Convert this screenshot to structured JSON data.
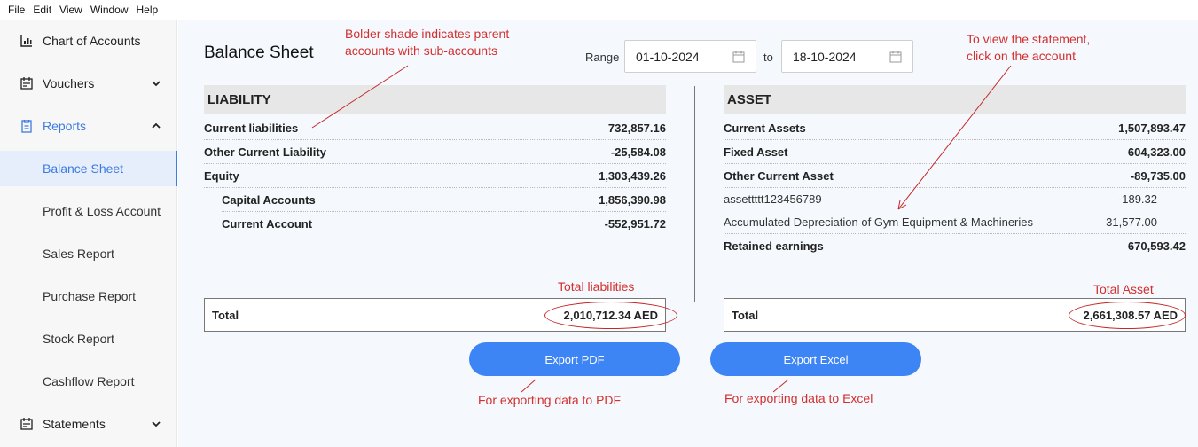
{
  "menu": [
    "File",
    "Edit",
    "View",
    "Window",
    "Help"
  ],
  "sidebar": {
    "items": [
      {
        "label": "Chart of Accounts",
        "icon": "chart-icon"
      },
      {
        "label": "Vouchers",
        "icon": "voucher-icon"
      },
      {
        "label": "Reports",
        "icon": "reports-icon"
      },
      {
        "label": "Statements",
        "icon": "statements-icon"
      }
    ],
    "report_subitems": [
      "Balance Sheet",
      "Profit & Loss Account",
      "Sales Report",
      "Purchase Report",
      "Stock Report",
      "Cashflow Report"
    ],
    "selected": "Balance Sheet"
  },
  "header": {
    "title": "Balance Sheet",
    "range_label": "Range",
    "from_date": "01-10-2024",
    "to_label": "to",
    "to_date": "18-10-2024"
  },
  "liability": {
    "heading": "LIABILITY",
    "rows": [
      {
        "name": "Current liabilities",
        "value": "732,857.16"
      },
      {
        "name": "Other Current Liability",
        "value": "-25,584.08"
      },
      {
        "name": "Equity",
        "value": "1,303,439.26"
      },
      {
        "name": "Capital Accounts",
        "value": "1,856,390.98"
      },
      {
        "name": "Current Account",
        "value": "-552,951.72"
      }
    ],
    "total_label": "Total",
    "total_value": "2,010,712.34 AED"
  },
  "asset": {
    "heading": "ASSET",
    "rows": [
      {
        "name": "Current Assets",
        "value": "1,507,893.47"
      },
      {
        "name": "Fixed Asset",
        "value": "604,323.00"
      },
      {
        "name": "Other Current Asset",
        "value": "-89,735.00"
      },
      {
        "name": "assettttt123456789",
        "value": "-189.32"
      },
      {
        "name": "Accumulated Depreciation of Gym Equipment & Machineries",
        "value": "-31,577.00"
      },
      {
        "name": "Retained earnings",
        "value": "670,593.42"
      }
    ],
    "total_label": "Total",
    "total_value": "2,661,308.57 AED"
  },
  "buttons": {
    "export_pdf": "Export PDF",
    "export_excel": "Export Excel"
  },
  "annotations": {
    "bolder_shade": [
      "Bolder shade indicates parent",
      "accounts with sub-accounts"
    ],
    "view_statement": [
      "To view the statement,",
      "click on the account"
    ],
    "total_liabilities": "Total liabilities",
    "total_asset": "Total Asset",
    "export_pdf_note": "For exporting data to PDF",
    "export_excel_note": "For exporting data to Excel"
  },
  "colors": {
    "accent": "#3d7be0",
    "button": "#3d84f5",
    "annotation": "#d32f2f"
  }
}
